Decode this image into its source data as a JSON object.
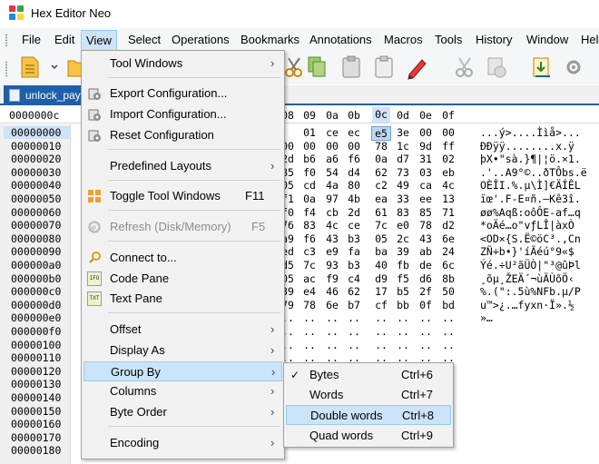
{
  "app": {
    "title": "Hex Editor Neo"
  },
  "menubar": [
    "File",
    "Edit",
    "View",
    "Select",
    "Operations",
    "Bookmarks",
    "Annotations",
    "Macros",
    "Tools",
    "History",
    "Window",
    "Help"
  ],
  "doc_tab": {
    "label": "unlock_payl"
  },
  "hex_header": {
    "offset_label": "0000000c",
    "columns": [
      "08",
      "09",
      "0a",
      "0b",
      "0c",
      "0d",
      "0e",
      "0f"
    ],
    "highlight_column": "0c"
  },
  "rows": [
    {
      "offset": "00000000",
      "hex": [
        "01",
        "ce",
        "ec",
        "e5",
        "3e",
        "00",
        "00"
      ],
      "ascii": "...ý>....Ììå>..."
    },
    {
      "offset": "00000010",
      "hex": [
        "00",
        "00",
        "00",
        "00",
        "78",
        "1c",
        "9d",
        "ff"
      ],
      "ascii": "ÐÐÿÿ........x.ÿ"
    },
    {
      "offset": "00000020",
      "hex": [
        "2d",
        "b6",
        "a6",
        "f6",
        "0a",
        "d7",
        "31",
        "02"
      ],
      "ascii": "þX•\"sà.}¶|¦ö.×1."
    },
    {
      "offset": "00000030",
      "hex": [
        "85",
        "f0",
        "54",
        "d4",
        "62",
        "73",
        "03",
        "eb"
      ],
      "ascii": ".'..A9°©..ðTÔbs.ë"
    },
    {
      "offset": "00000040",
      "hex": [
        "05",
        "cd",
        "4a",
        "80",
        "c2",
        "49",
        "ca",
        "4c"
      ],
      "ascii": "OÈÎI.%.µ\\Ì]€ÄÍÊL"
    },
    {
      "offset": "00000050",
      "hex": [
        "f1",
        "0a",
        "97",
        "4b",
        "ea",
        "33",
        "ee",
        "13"
      ],
      "ascii": "ïœ'.F-E¤ñ.—Kê3î."
    },
    {
      "offset": "00000060",
      "hex": [
        "f0",
        "f4",
        "cb",
        "2d",
        "61",
        "83",
        "85",
        "71"
      ],
      "ascii": "øø%Aqß:oôÔE-af…q"
    },
    {
      "offset": "00000070",
      "hex": [
        "76",
        "83",
        "4c",
        "ce",
        "7c",
        "e0",
        "78",
        "d2"
      ],
      "ascii": "*oÄé…o\"vƒLÎ|àxÒ"
    },
    {
      "offset": "00000080",
      "hex": [
        "a9",
        "f6",
        "43",
        "b3",
        "05",
        "2c",
        "43",
        "6e"
      ],
      "ascii": "<OD×{S.Ë©öC³.,Cn"
    },
    {
      "offset": "00000090",
      "hex": [
        "ed",
        "c3",
        "e9",
        "fa",
        "ba",
        "39",
        "ab",
        "24"
      ],
      "ascii": "ZÑ÷b•}'íÃéú°9«$"
    },
    {
      "offset": "000000a0",
      "hex": [
        "d5",
        "7c",
        "93",
        "b3",
        "40",
        "fb",
        "de",
        "6c"
      ],
      "ascii": "Ýé.÷U²ãÜÒ|\"³@ûÞl"
    },
    {
      "offset": "000000b0",
      "hex": [
        "05",
        "ac",
        "f9",
        "c4",
        "d9",
        "f5",
        "d6",
        "8b"
      ],
      "ascii": "¸õµ¸ŽEÄ´¬ùÄÙõÖ‹"
    },
    {
      "offset": "000000c0",
      "hex": [
        "39",
        "e4",
        "46",
        "62",
        "17",
        "b5",
        "2f",
        "50"
      ],
      "ascii": "%.(\":.5ù%NFb.µ/P"
    },
    {
      "offset": "000000d0",
      "hex": [
        "79",
        "78",
        "6e",
        "b7",
        "cf",
        "bb",
        "0f",
        "bd"
      ],
      "ascii": "u™>¿.…fyxn·Ï».½"
    },
    {
      "offset": "000000e0",
      "hex": [
        "..",
        "..",
        "..",
        "..",
        "..",
        "..",
        "..",
        ".."
      ],
      "ascii": "»…"
    },
    {
      "offset": "000000f0",
      "hex": [
        "..",
        "..",
        "..",
        "..",
        "..",
        "..",
        "..",
        ".."
      ],
      "ascii": ""
    },
    {
      "offset": "00000100",
      "hex": [
        "..",
        "..",
        "..",
        "..",
        "..",
        "..",
        "..",
        ".."
      ],
      "ascii": ""
    },
    {
      "offset": "00000110",
      "hex": [
        "..",
        "..",
        "..",
        "..",
        "..",
        "..",
        "..",
        ".."
      ],
      "ascii": ""
    },
    {
      "offset": "00000120",
      "hex": [],
      "ascii": ""
    },
    {
      "offset": "00000130",
      "hex": [],
      "ascii": ""
    },
    {
      "offset": "00000140",
      "hex": [],
      "ascii": ""
    },
    {
      "offset": "00000150",
      "hex": [],
      "ascii": ""
    },
    {
      "offset": "00000160",
      "hex": [],
      "ascii": ""
    },
    {
      "offset": "00000170",
      "hex": [],
      "ascii": ""
    },
    {
      "offset": "00000180",
      "hex": [],
      "ascii": ""
    }
  ],
  "view_menu": {
    "items": [
      {
        "label": "Tool Windows",
        "shortcut": "",
        "submenu": true,
        "icon": ""
      },
      {
        "label": "Export Configuration...",
        "shortcut": "",
        "submenu": false,
        "icon": "export-config-icon"
      },
      {
        "label": "Import Configuration...",
        "shortcut": "",
        "submenu": false,
        "icon": "import-config-icon"
      },
      {
        "label": "Reset Configuration",
        "shortcut": "",
        "submenu": false,
        "icon": "reset-config-icon"
      },
      {
        "label": "Predefined Layouts",
        "shortcut": "",
        "submenu": true,
        "icon": ""
      },
      {
        "label": "Toggle Tool Windows",
        "shortcut": "F11",
        "submenu": false,
        "icon": "toggle-windows-icon"
      },
      {
        "label": "Refresh (Disk/Memory)",
        "shortcut": "F5",
        "submenu": false,
        "icon": "refresh-icon",
        "disabled": true
      },
      {
        "label": "Connect to...",
        "shortcut": "",
        "submenu": false,
        "icon": "connect-icon"
      },
      {
        "label": "Code Pane",
        "shortcut": "",
        "submenu": false,
        "icon": "code-pane-icon"
      },
      {
        "label": "Text Pane",
        "shortcut": "",
        "submenu": false,
        "icon": "text-pane-icon"
      },
      {
        "label": "Offset",
        "shortcut": "",
        "submenu": true,
        "icon": ""
      },
      {
        "label": "Display As",
        "shortcut": "",
        "submenu": true,
        "icon": ""
      },
      {
        "label": "Group By",
        "shortcut": "",
        "submenu": true,
        "icon": "",
        "highlighted": true
      },
      {
        "label": "Columns",
        "shortcut": "",
        "submenu": true,
        "icon": ""
      },
      {
        "label": "Byte Order",
        "shortcut": "",
        "submenu": true,
        "icon": ""
      },
      {
        "label": "Encoding",
        "shortcut": "",
        "submenu": true,
        "icon": ""
      }
    ],
    "code_pane_icon_text": "IFO",
    "text_pane_icon_text": "TXT"
  },
  "group_by_menu": {
    "items": [
      {
        "label": "Bytes",
        "shortcut": "Ctrl+6",
        "checked": true
      },
      {
        "label": "Words",
        "shortcut": "Ctrl+7",
        "checked": false
      },
      {
        "label": "Double words",
        "shortcut": "Ctrl+8",
        "checked": false,
        "highlighted": true
      },
      {
        "label": "Quad words",
        "shortcut": "Ctrl+9",
        "checked": false
      }
    ],
    "check_glyph": "✓"
  },
  "colors": {
    "accent": "#1e5fa8",
    "menu_highlight": "#cce4f7",
    "selection": "#bcd7f2"
  }
}
